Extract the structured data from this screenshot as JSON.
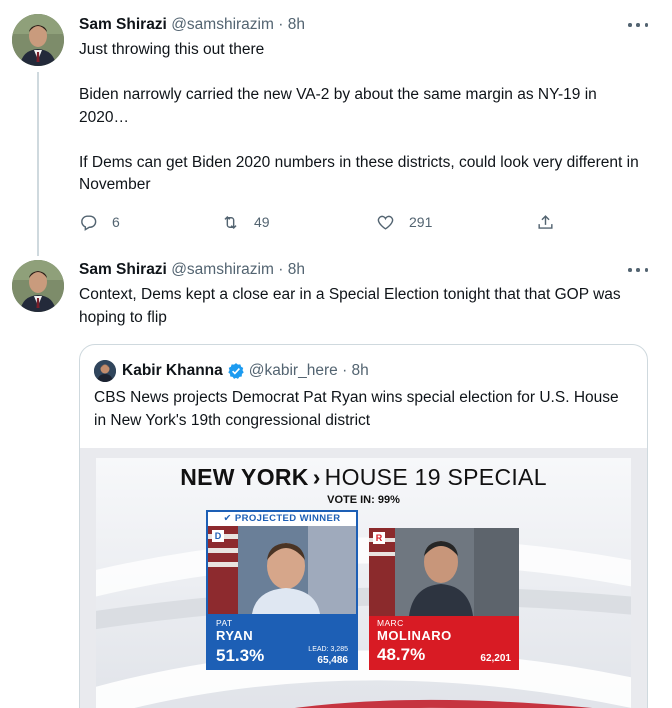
{
  "tweet1": {
    "name": "Sam Shirazi",
    "handle": "@samshirazim",
    "separator": "·",
    "time": "8h",
    "text": "Just throwing this out there\n\nBiden narrowly carried the new VA-2 by about the same margin as NY-19 in 2020…\n\nIf Dems can get Biden 2020 numbers in these districts, could look very different in November",
    "replies": "6",
    "retweets": "49",
    "likes": "291",
    "icons": {
      "reply": "reply-icon",
      "retweet": "retweet-icon",
      "like": "heart-icon",
      "share": "share-icon",
      "more": "more-icon"
    }
  },
  "tweet2": {
    "name": "Sam Shirazi",
    "handle": "@samshirazim",
    "separator": "·",
    "time": "8h",
    "text": "Context, Dems kept a close ear in a Special Election tonight that that GOP was hoping to flip"
  },
  "quote": {
    "name": "Kabir Khanna",
    "handle": "@kabir_here",
    "separator": "·",
    "time": "8h",
    "text": "CBS News projects Democrat Pat Ryan wins special election for U.S. House in New York's 19th congressional district",
    "graphic": {
      "state": "NEW YORK",
      "chevron": "›",
      "race": "HOUSE 19 SPECIAL",
      "vote_in": "VOTE IN: 99%",
      "winner_label": "✔ PROJECTED WINNER",
      "dem": {
        "party": "D",
        "first": "PAT",
        "last": "RYAN",
        "pct": "51.3%",
        "lead": "LEAD: 3,285",
        "votes": "65,486",
        "color": "#1d5fb5"
      },
      "rep": {
        "party": "R",
        "first": "MARC",
        "last": "MOLINARO",
        "pct": "48.7%",
        "votes": "62,201",
        "color": "#d81b24"
      }
    }
  },
  "colors": {
    "text": "#0f1419",
    "secondary": "#536471",
    "border": "#cfd9de",
    "verified": "#1d9bf0"
  }
}
